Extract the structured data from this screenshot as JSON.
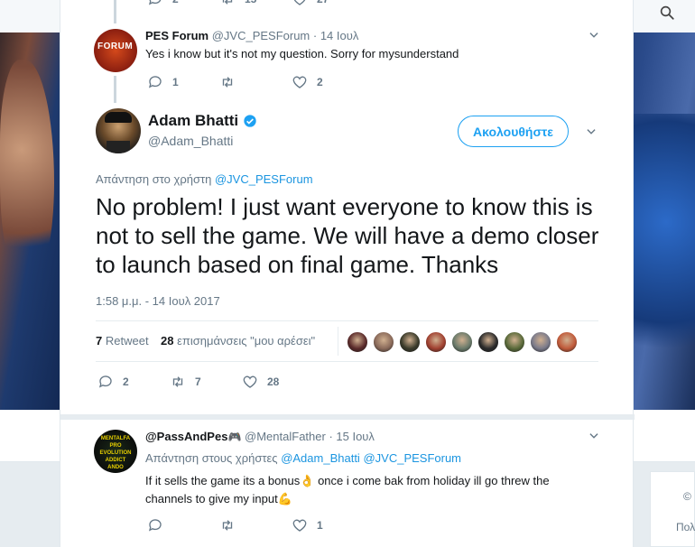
{
  "colors": {
    "accent": "#1da1f2",
    "link": "#1b95e0",
    "muted": "#657786",
    "text": "#14171a",
    "verified": "#1da1f2"
  },
  "top_tweet_actions": {
    "replies": "2",
    "retweets": "15",
    "likes": "27"
  },
  "tweet1": {
    "name": "PES Forum",
    "handle": "@JVC_PESForum",
    "date": "· 14 Ιουλ",
    "text": "Yes i know but it's not my question. Sorry for mysunderstand",
    "avatar_text": "FORUM",
    "replies": "1",
    "retweets": "",
    "likes": "2"
  },
  "main_tweet": {
    "name": "Adam Bhatti",
    "verified_icon": "verified-badge-icon",
    "handle": "@Adam_Bhatti",
    "follow_label": "Ακολουθήστε",
    "reply_to_prefix": "Απάντηση στο χρήστη",
    "reply_to_handle": "@JVC_PESForum",
    "text": "No problem! I just want everyone to know this is not to sell the game. We will have a demo closer to launch based on final game. Thanks",
    "timestamp": "1:58 μ.μ. - 14 Ιουλ 2017",
    "retweet_count": "7",
    "retweet_label": "Retweet",
    "like_count": "28",
    "like_label": "επισημάνσεις \"μου αρέσει\"",
    "replies": "2",
    "retweets": "7",
    "likes": "28",
    "liker_colors": [
      "#5a2a2a",
      "#8a6a5a",
      "#3a3a2a",
      "#a04030",
      "#6a7a6a",
      "#2a2a2a",
      "#5a6a3a",
      "#7a7a8a",
      "#c05a3a"
    ]
  },
  "reply_tweet": {
    "name": "@PassAndPes",
    "name_emoji": "🎮",
    "handle": "@MentalFather",
    "date": "· 15 Ιουλ",
    "reply_to_prefix": "Απάντηση στους χρήστες",
    "reply_to_handle1": "@Adam_Bhatti",
    "reply_to_handle2": "@JVC_PESForum",
    "text_part1": "If it sells the game its a bonus",
    "emoji1": "👌",
    "text_part2": " once i come bak from holiday ill go threw the channels to give my input",
    "emoji2": "💪",
    "avatar_text": "MENTALFA PRO EVOLUTION ADDICT ANDO",
    "replies": "",
    "retweets": "",
    "likes": "1"
  },
  "sidebar": {
    "copyright": "©",
    "policy": "Πολ"
  }
}
